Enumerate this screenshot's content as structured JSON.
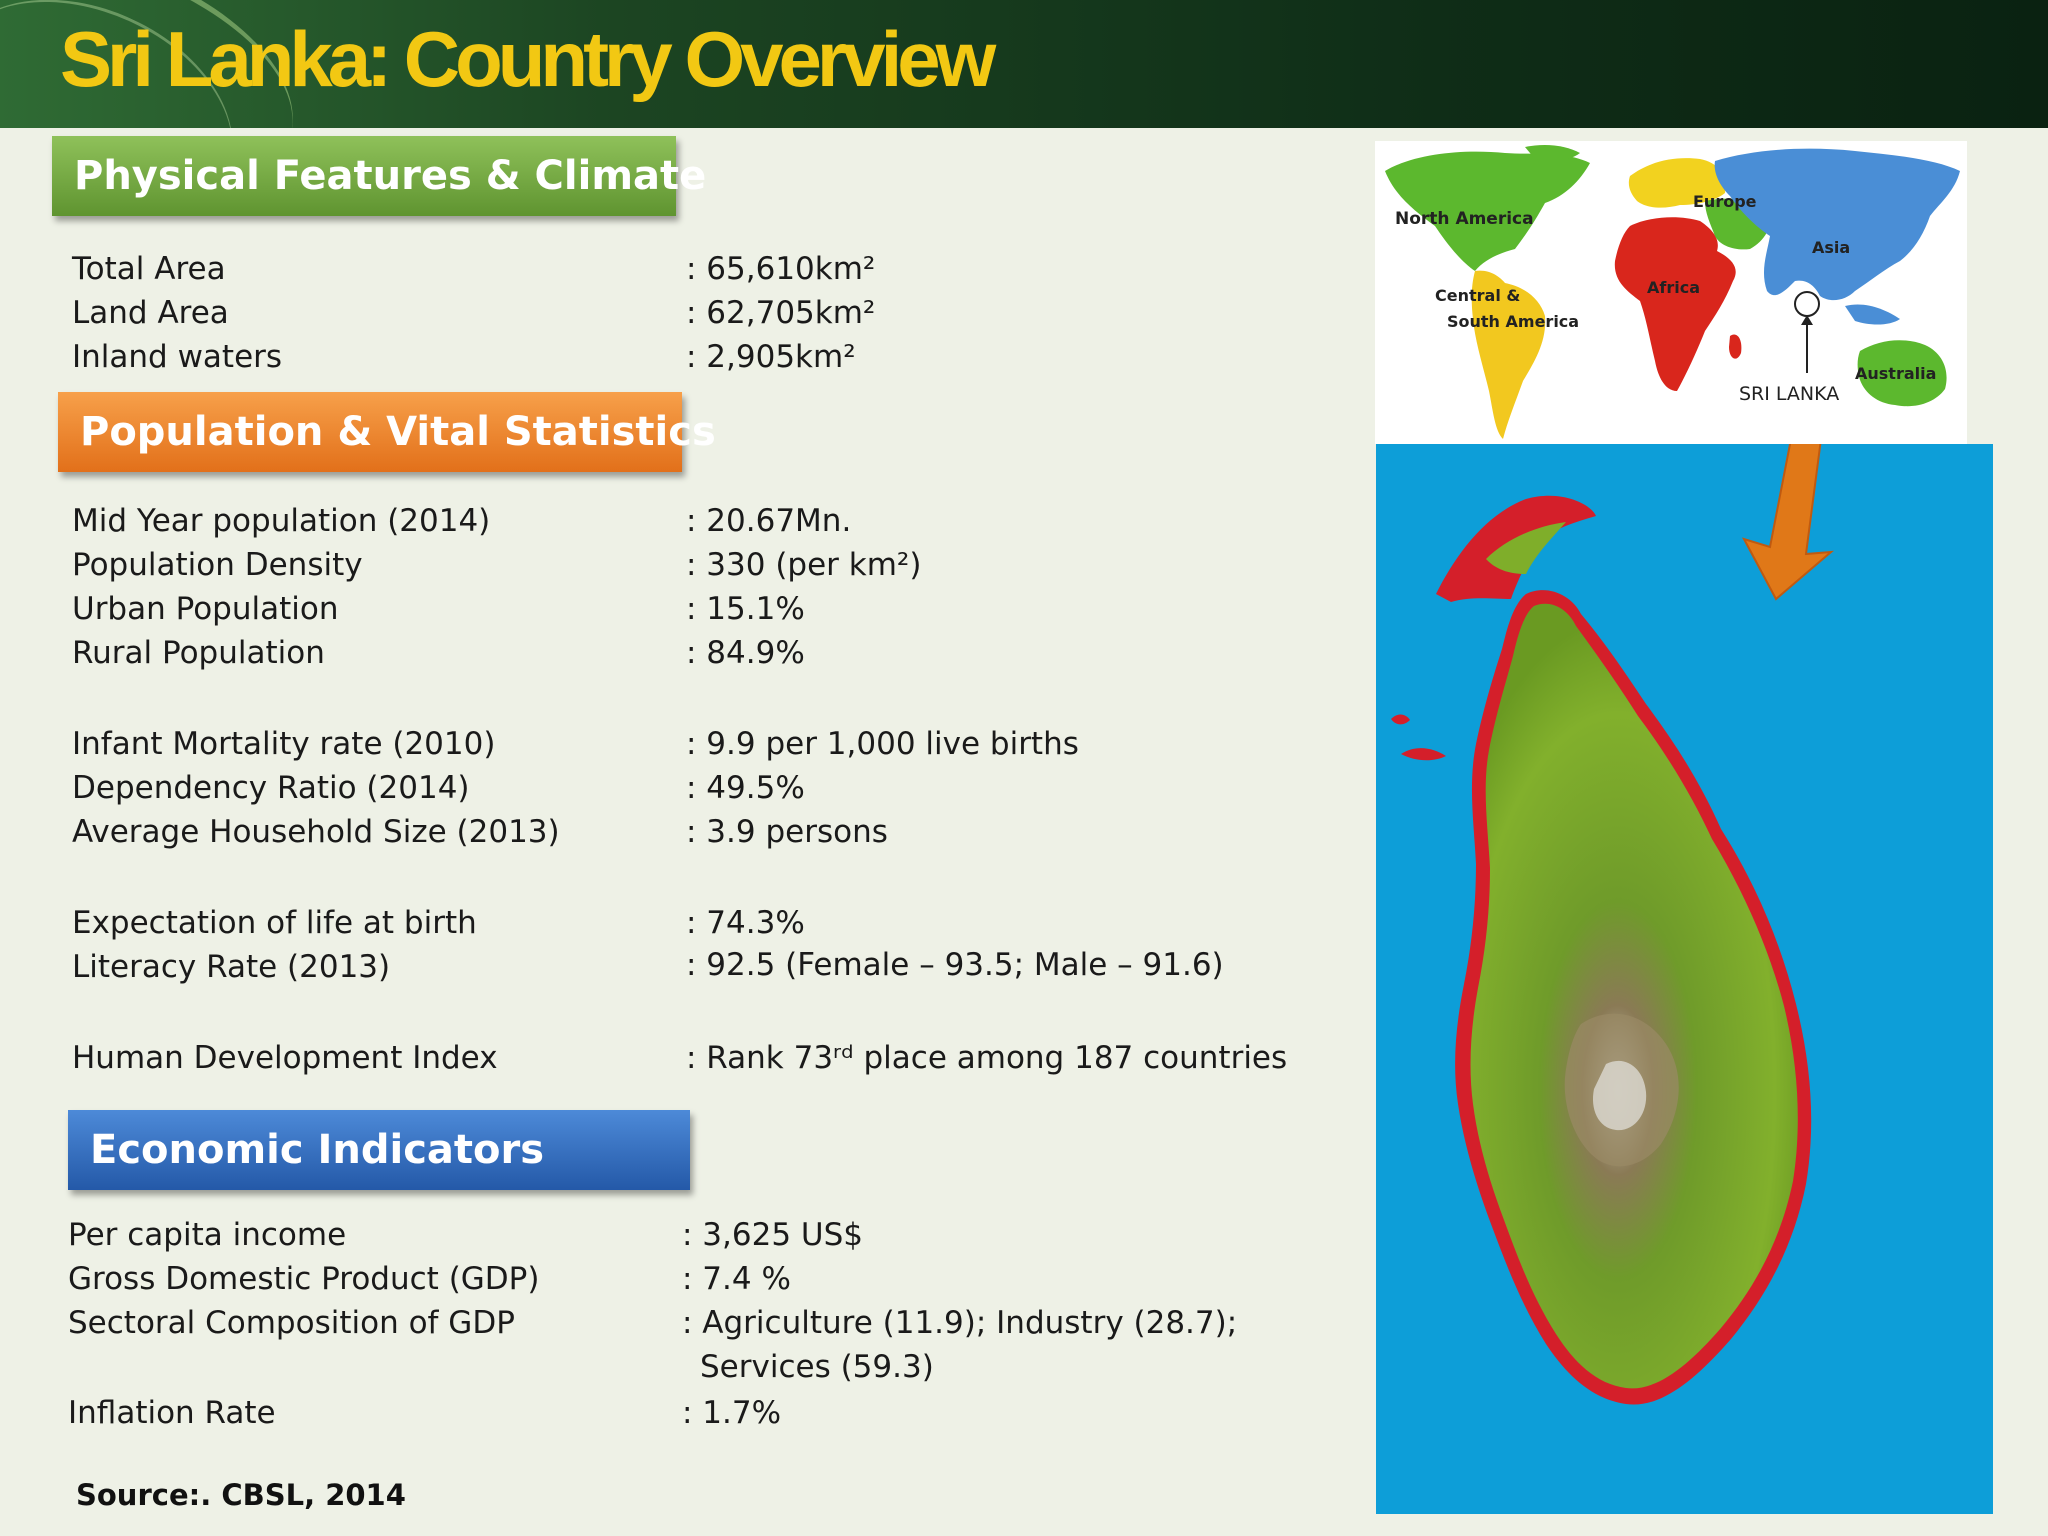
{
  "title": "Sri Lanka: Country Overview",
  "sections": {
    "physical": {
      "heading": "Physical Features & Climate",
      "rows": [
        {
          "label": "Total Area",
          "value": ": 65,610km²"
        },
        {
          "label": "Land Area",
          "value": ": 62,705km²"
        },
        {
          "label": "Inland waters",
          "value": ": 2,905km²"
        }
      ]
    },
    "population": {
      "heading": "Population & Vital Statistics",
      "rows": [
        {
          "label": "Mid Year population (2014)",
          "value": ": 20.67Mn."
        },
        {
          "label": "Population Density",
          "value": ": 330 (per km²)"
        },
        {
          "label": "Urban Population",
          "value": ": 15.1%"
        },
        {
          "label": "Rural Population",
          "value": ": 84.9%"
        },
        {
          "label": "Infant Mortality rate (2010)",
          "value": ": 9.9 per 1,000 live births"
        },
        {
          "label": "Dependency Ratio (2014)",
          "value": ": 49.5%"
        },
        {
          "label": "Average Household Size (2013)",
          "value": ": 3.9 persons"
        },
        {
          "label": "Expectation of life at birth",
          "value": ": 74.3%"
        },
        {
          "label": "Literacy Rate (2013)",
          "value": ": 92.5 (Female – 93.5; Male – 91.6)"
        },
        {
          "label": "Human Development Index",
          "value": ": Rank 73ʳᵈ place among 187 countries"
        }
      ]
    },
    "economic": {
      "heading": "Economic Indicators",
      "rows": [
        {
          "label": "Per capita income",
          "value": ": 3,625 US$"
        },
        {
          "label": "Gross Domestic Product (GDP)",
          "value": ": 7.4 %"
        },
        {
          "label": "Sectoral Composition of GDP",
          "value": ": Agriculture (11.9); Industry (28.7);",
          "value_cont": "Services (59.3)"
        },
        {
          "label": "Inflation Rate",
          "value": ": 1.7%"
        }
      ]
    }
  },
  "source": "Source:. CBSL, 2014",
  "world_map": {
    "labels": {
      "north_america": "North America",
      "central_south_america_1": "Central &",
      "central_south_america_2": "South America",
      "europe": "Europe",
      "africa": "Africa",
      "asia": "Asia",
      "australia": "Australia",
      "sri_lanka": "SRI LANKA"
    },
    "colors": {
      "americas_north": "#5cb82e",
      "americas_south": "#f2c81f",
      "europe": "#f2d21f",
      "africa": "#d9261c",
      "asia": "#4a8ed6",
      "australia": "#5cb82e"
    }
  },
  "island_map": {
    "colors": {
      "sea": "#0d9ed8",
      "coast": "#d41f2a",
      "lowland": "#7fae2a",
      "highland": "#8a7a55",
      "arrow": "#e07818"
    }
  }
}
